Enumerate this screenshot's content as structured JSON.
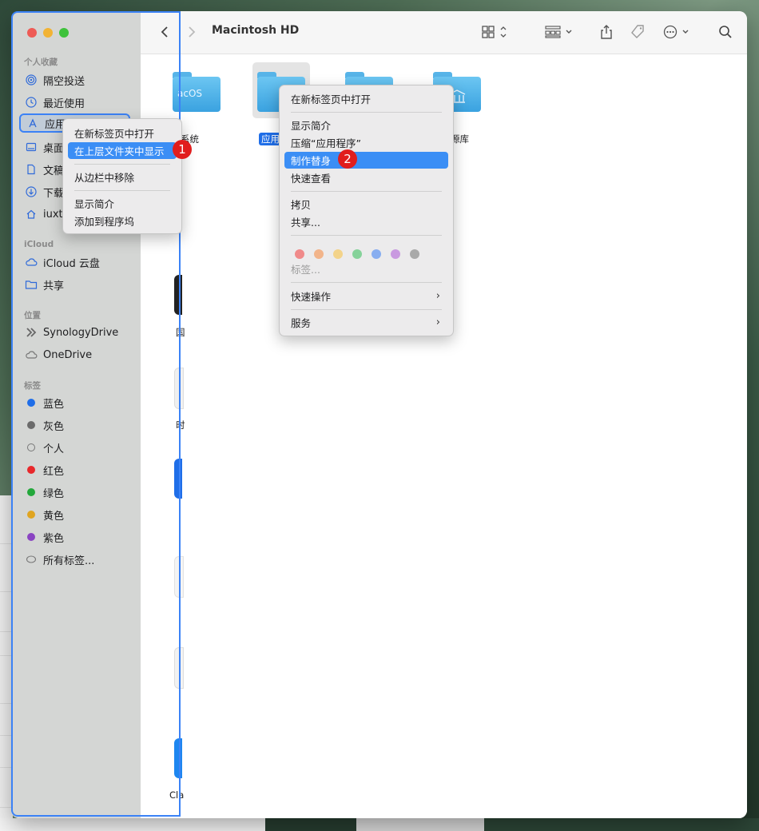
{
  "window": {
    "title": "Macintosh HD"
  },
  "sidebar": {
    "favorites_header": "个人收藏",
    "favorites": [
      {
        "label": "隔空投送",
        "icon": "airdrop-icon"
      },
      {
        "label": "最近使用",
        "icon": "clock-icon"
      },
      {
        "label": "应用",
        "icon": "applications-icon"
      },
      {
        "label": "桌面",
        "icon": "desktop-icon"
      },
      {
        "label": "文稿",
        "icon": "document-icon"
      },
      {
        "label": "下载",
        "icon": "download-icon"
      },
      {
        "label": "iuxt",
        "icon": "home-icon"
      }
    ],
    "icloud_header": "iCloud",
    "icloud": [
      {
        "label": "iCloud 云盘",
        "icon": "cloud-icon"
      },
      {
        "label": "共享",
        "icon": "shared-folder-icon"
      }
    ],
    "locations_header": "位置",
    "locations": [
      {
        "label": "SynologyDrive",
        "icon": "synology-icon"
      },
      {
        "label": "OneDrive",
        "icon": "cloud-icon"
      }
    ],
    "tags_header": "标签",
    "tags": [
      {
        "label": "蓝色",
        "color": "#1f6ee8"
      },
      {
        "label": "灰色",
        "color": "#6b6b6b"
      },
      {
        "label": "个人",
        "color": ""
      },
      {
        "label": "红色",
        "color": "#e8282b"
      },
      {
        "label": "绿色",
        "color": "#23a83b"
      },
      {
        "label": "黄色",
        "color": "#e0a521"
      },
      {
        "label": "紫色",
        "color": "#8a44c2"
      },
      {
        "label": "所有标签...",
        "color": ""
      }
    ]
  },
  "content": {
    "folders": [
      {
        "label": "系统",
        "overlay": "acOS"
      },
      {
        "label": "应用",
        "overlay": ""
      },
      {
        "label": "",
        "overlay": ""
      },
      {
        "label": "源库",
        "overlay": ""
      }
    ],
    "partial_labels": [
      "国",
      "时",
      "Cla"
    ]
  },
  "menu1": {
    "items": [
      "在新标签页中打开",
      "在上层文件夹中显示",
      "从边栏中移除",
      "显示简介",
      "添加到程序坞"
    ],
    "highlighted_index": 1,
    "badge": "1"
  },
  "menu2": {
    "items": [
      "在新标签页中打开",
      "显示简介",
      "压缩“应用程序”",
      "制作替身",
      "快速查看",
      "拷贝",
      "共享...",
      "标签...",
      "快速操作",
      "服务"
    ],
    "highlighted_index": 3,
    "badge": "2",
    "tag_colors": [
      "#f08a8a",
      "#f2b48a",
      "#f3d38a",
      "#86d29a",
      "#88aef0",
      "#c99ae0",
      "#a9a9a9"
    ]
  }
}
